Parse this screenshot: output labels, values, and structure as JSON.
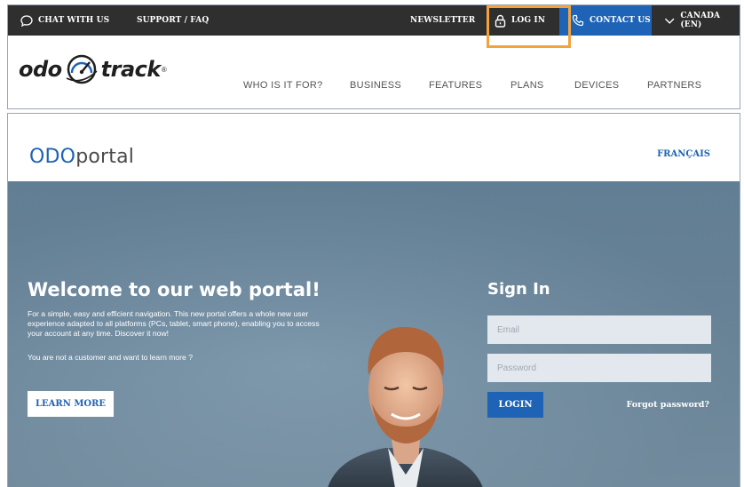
{
  "utility_bar": {
    "chat": "CHAT WITH US",
    "support": "SUPPORT / FAQ",
    "newsletter": "NEWSLETTER",
    "login": "LOG IN",
    "contact": "CONTACT US",
    "region": "CANADA (EN)"
  },
  "brand": {
    "word_left": "odo",
    "word_right": "track",
    "reg": "®"
  },
  "nav": [
    "WHO IS IT FOR?",
    "BUSINESS",
    "FEATURES",
    "PLANS",
    "DEVICES",
    "PARTNERS"
  ],
  "portal": {
    "logo_blue": "ODO",
    "logo_rest": "portal",
    "language": "FRANÇAIS"
  },
  "welcome": {
    "title": "Welcome to our web portal!",
    "text": "For a simple, easy and efficient navigation. This new portal offers a whole new user experience adapted to all platforms (PCs, tablet, smart phone), enabling you to access your account at any time. Discover it now!",
    "question": "You are not a customer and want to learn more ?",
    "cta": "LEARN MORE"
  },
  "signin": {
    "title": "Sign In",
    "email_placeholder": "Email",
    "password_placeholder": "Password",
    "login_label": "LOGIN",
    "forgot": "Forgot password?"
  },
  "colors": {
    "brand_blue": "#1e63b5",
    "highlight_orange": "#f2a33c",
    "utility_bar": "#2f2f2f"
  },
  "icons": {
    "chat": "chat-bubble-icon",
    "login": "lock-icon",
    "contact": "phone-icon",
    "region": "chevron-down-icon"
  }
}
